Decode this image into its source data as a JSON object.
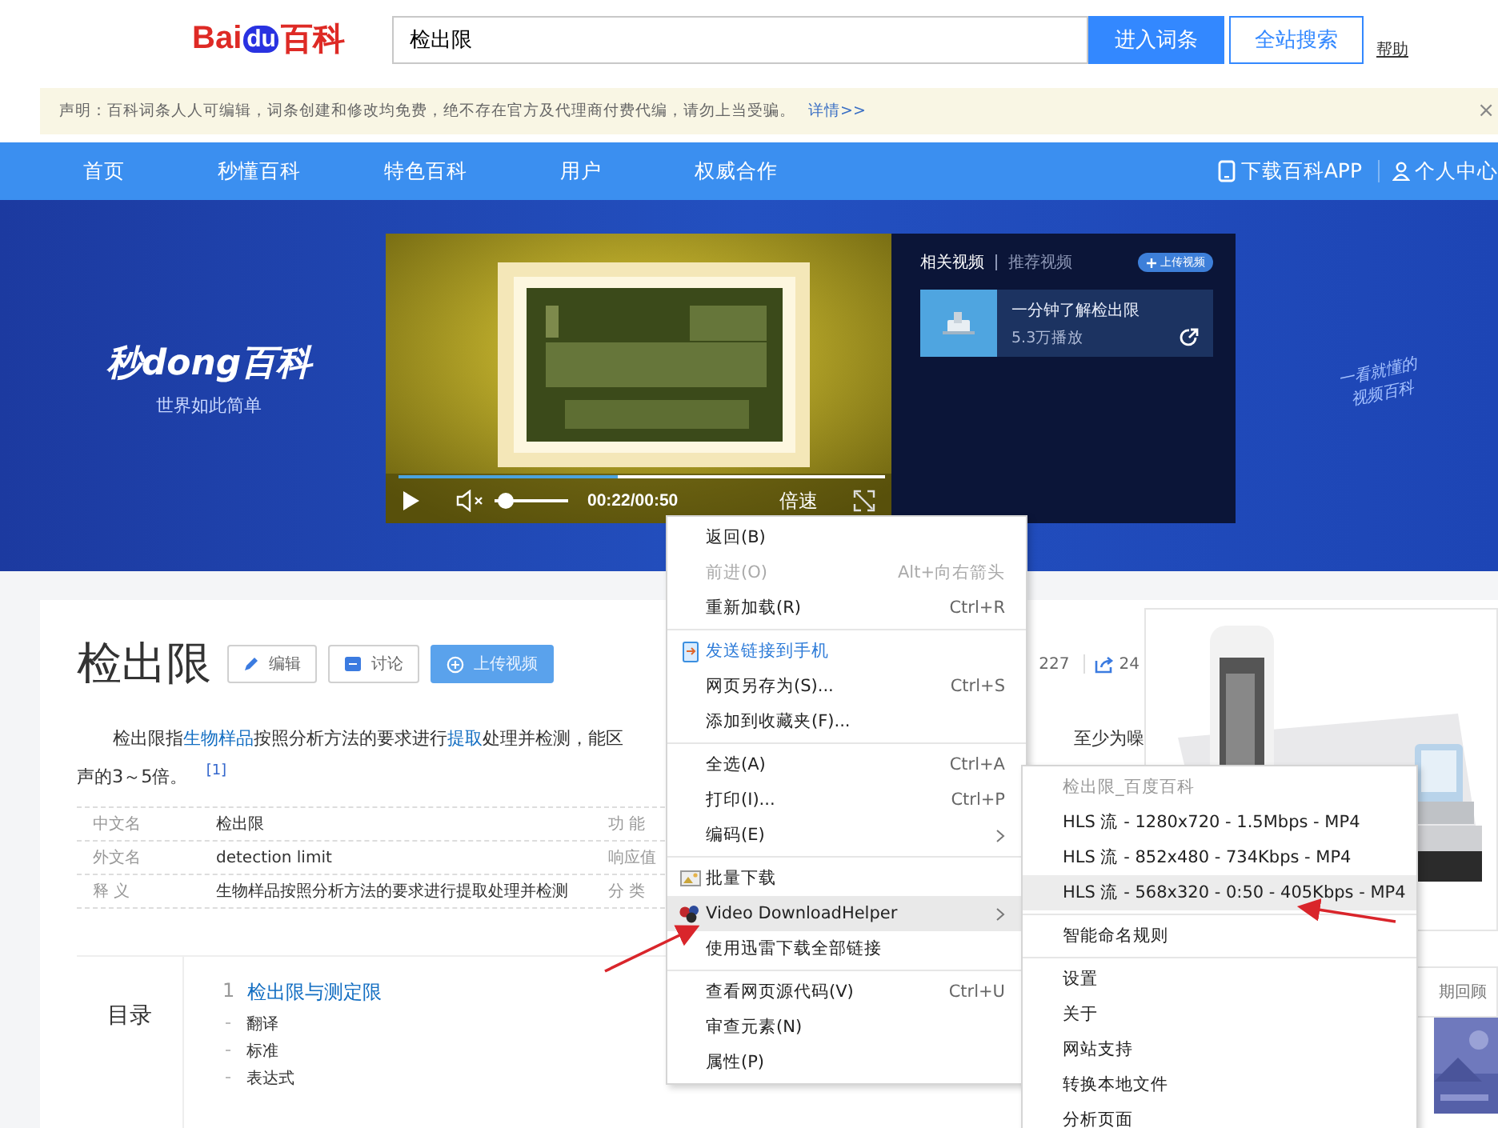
{
  "header": {
    "logo": {
      "part_1": "Bai",
      "part_2": "du",
      "part_3": "百科"
    },
    "search": {
      "value": "检出限"
    },
    "enter_button": "进入词条",
    "search_button": "全站搜索",
    "help_link": "帮助"
  },
  "notice": {
    "text": "声明：百科词条人人可编辑，词条创建和修改均免费，绝不存在官方及代理商付费代编，请勿上当受骗。",
    "link": "详情>>",
    "close": "×"
  },
  "nav": {
    "items": [
      "首页",
      "秒懂百科",
      "特色百科",
      "用户",
      "权威合作"
    ],
    "app_link": "下载百科APP",
    "user_link": "个人中心"
  },
  "banner": {
    "brand": "秒dong百科",
    "slogan": "世界如此简单",
    "handwriting": [
      "一看就懂的",
      "视频百科"
    ],
    "player": {
      "progress": {
        "level": 0.45
      },
      "muted": true,
      "volume": {
        "level": 0.05
      },
      "time": "00:22/00:50",
      "speed": "倍速"
    },
    "side": {
      "tabs": [
        {
          "label": "相关视频",
          "selected": true
        },
        {
          "label": "推荐视频",
          "selected": false
        }
      ],
      "upload": "上传视频",
      "videos": [
        {
          "title": "一分钟了解检出限",
          "plays": "5.3万播放"
        }
      ]
    }
  },
  "article": {
    "title": "检出限",
    "actions": [
      {
        "kind": "edit",
        "label": "编辑"
      },
      {
        "kind": "discuss",
        "label": "讨论"
      },
      {
        "kind": "upload",
        "label": "上传视频"
      }
    ],
    "likes": "227",
    "shares": "24",
    "summary": {
      "parts": [
        {
          "text": "检出限指",
          "link": false
        },
        {
          "text": "生物样品",
          "link": true
        },
        {
          "text": "按照分析方法的要求进行",
          "link": false
        },
        {
          "text": "提取",
          "link": true
        },
        {
          "text": "处理并检测，能区",
          "link": false
        }
      ],
      "line_1_end": "至少为噪",
      "line_2": "声的3～5倍。",
      "ref": "[1]"
    },
    "infobox": [
      {
        "label": "中文名",
        "value": "检出限",
        "label_2": "功 能"
      },
      {
        "label": "外文名",
        "value": "detection limit",
        "label_2": "响应值"
      },
      {
        "label": "释 义",
        "value": "生物样品按照分析方法的要求进行提取处理并检测",
        "label_2": "分 类"
      }
    ],
    "toc": {
      "heading": "目录",
      "sections": [
        {
          "number": "1",
          "title": "检出限与测定限",
          "children": [
            {
              "title": "翻译"
            },
            {
              "title": "标准"
            },
            {
              "title": "表达式"
            }
          ]
        }
      ]
    },
    "side_tab": "期回顾"
  },
  "context_menu": {
    "groups": [
      [
        {
          "kind": "item",
          "label": "返回(B)",
          "disabled": false,
          "selected": false
        },
        {
          "kind": "item",
          "label": "前进(O)",
          "shortcut": "Alt+向右箭头",
          "disabled": true,
          "selected": false
        },
        {
          "kind": "item",
          "label": "重新加载(R)",
          "shortcut": "Ctrl+R",
          "disabled": false,
          "selected": false
        }
      ],
      [
        {
          "kind": "send",
          "label": "发送链接到手机",
          "disabled": false,
          "selected": false
        },
        {
          "kind": "item",
          "label": "网页另存为(S)...",
          "shortcut": "Ctrl+S",
          "disabled": false,
          "selected": false
        },
        {
          "kind": "item",
          "label": "添加到收藏夹(F)...",
          "disabled": false,
          "selected": false
        }
      ],
      [
        {
          "kind": "item",
          "label": "全选(A)",
          "shortcut": "Ctrl+A",
          "disabled": false,
          "selected": false
        },
        {
          "kind": "item",
          "label": "打印(I)...",
          "shortcut": "Ctrl+P",
          "disabled": false,
          "selected": false
        },
        {
          "kind": "item",
          "label": "编码(E)",
          "submenu": true,
          "disabled": false,
          "selected": false
        }
      ],
      [
        {
          "kind": "batch",
          "label": "批量下载",
          "disabled": false,
          "selected": false
        },
        {
          "kind": "helper",
          "label": "Video DownloadHelper",
          "submenu": true,
          "disabled": false,
          "selected": true
        },
        {
          "kind": "item",
          "label": "使用迅雷下载全部链接",
          "disabled": false,
          "selected": false
        }
      ],
      [
        {
          "kind": "item",
          "label": "查看网页源代码(V)",
          "shortcut": "Ctrl+U",
          "disabled": false,
          "selected": false
        },
        {
          "kind": "item",
          "label": "审查元素(N)",
          "disabled": false,
          "selected": false
        },
        {
          "kind": "item",
          "label": "属性(P)",
          "disabled": false,
          "selected": false
        }
      ]
    ]
  },
  "submenu": {
    "title": "检出限_百度百科",
    "groups": [
      [
        {
          "label": "HLS 流 - 1280x720 - 1.5Mbps - MP4",
          "selected": false
        },
        {
          "label": "HLS 流 - 852x480 - 734Kbps - MP4",
          "selected": false
        },
        {
          "label": "HLS 流 - 568x320 - 0:50 - 405Kbps - MP4",
          "selected": true
        }
      ],
      [
        {
          "label": "智能命名规则",
          "selected": false
        }
      ],
      [
        {
          "label": "设置",
          "selected": false
        },
        {
          "label": "关于",
          "selected": false
        },
        {
          "label": "网站支持",
          "selected": false
        },
        {
          "label": "转换本地文件",
          "selected": false
        },
        {
          "label": "分析页面",
          "selected": false
        }
      ]
    ]
  }
}
